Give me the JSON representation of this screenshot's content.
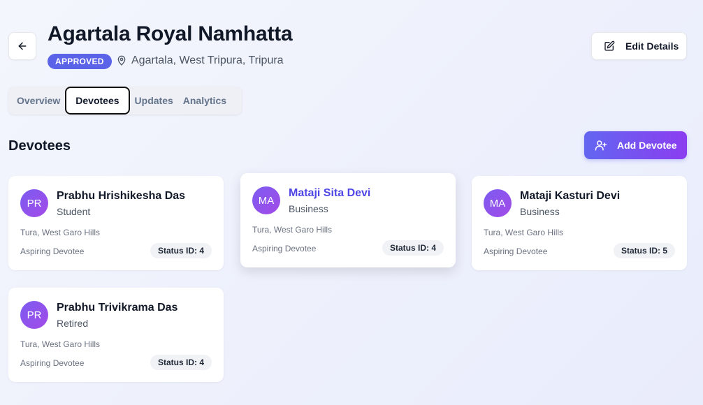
{
  "header": {
    "title": "Agartala Royal Namhatta",
    "badge": "APPROVED",
    "location": "Agartala, West Tripura, Tripura",
    "edit_label": "Edit Details"
  },
  "tabs": [
    {
      "label": "Overview"
    },
    {
      "label": "Devotees"
    },
    {
      "label": "Updates"
    },
    {
      "label": "Analytics"
    }
  ],
  "section": {
    "title": "Devotees",
    "add_label": "Add Devotee"
  },
  "devotees": [
    {
      "initials": "PR",
      "name": "Prabhu Hrishikesha Das",
      "occupation": "Student",
      "location": "Tura, West Garo Hills",
      "level": "Aspiring Devotee",
      "status": "Status ID: 4"
    },
    {
      "initials": "MA",
      "name": "Mataji Sita Devi",
      "occupation": "Business",
      "location": "Tura, West Garo Hills",
      "level": "Aspiring Devotee",
      "status": "Status ID: 4"
    },
    {
      "initials": "MA",
      "name": "Mataji Kasturi Devi",
      "occupation": "Business",
      "location": "Tura, West Garo Hills",
      "level": "Aspiring Devotee",
      "status": "Status ID: 5"
    },
    {
      "initials": "PR",
      "name": "Prabhu Trivikrama Das",
      "occupation": "Retired",
      "location": "Tura, West Garo Hills",
      "level": "Aspiring Devotee",
      "status": "Status ID: 4"
    }
  ]
}
